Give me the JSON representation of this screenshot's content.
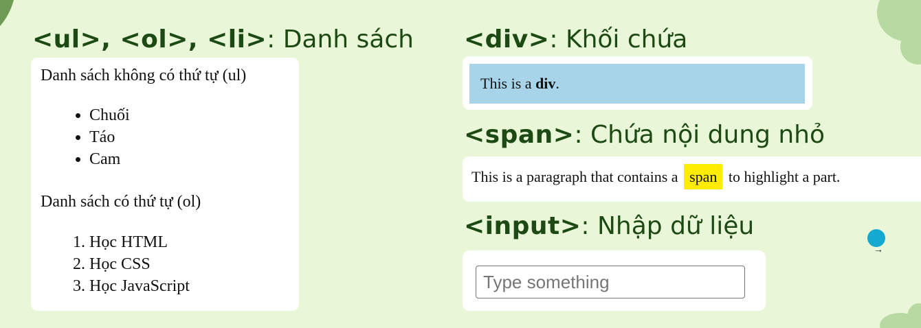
{
  "headings": {
    "lists": {
      "tag": "<ul>, <ol>, <li>",
      "text": ": Danh sách"
    },
    "div": {
      "tag": "<div>",
      "text": ": Khối chứa"
    },
    "span": {
      "tag": "<span>",
      "text": ": Chứa nội dung nhỏ"
    },
    "input": {
      "tag": "<input>",
      "text": ": Nhập dữ liệu"
    }
  },
  "unordered_list": {
    "heading": "Danh sách không có thứ tự (ul)",
    "items": [
      "Chuối",
      "Táo",
      "Cam"
    ]
  },
  "ordered_list": {
    "heading": "Danh sách có thứ tự (ol)",
    "items": [
      "Học HTML",
      "Học CSS",
      "Học JavaScript"
    ]
  },
  "div_demo": {
    "prefix": "This is a ",
    "bold": "div",
    "suffix": "."
  },
  "span_demo": {
    "before": "This is a paragraph that contains a",
    "highlight": "span",
    "after": "to highlight a part."
  },
  "input_demo": {
    "placeholder": "Type something",
    "value": ""
  },
  "cursor": {
    "arrow_glyph": "→"
  },
  "colors": {
    "background": "#e9f7d8",
    "heading_text": "#1d4a14",
    "div_fill": "#a8d4ea",
    "span_highlight": "#ffec00",
    "cursor_dot": "#13a9d0",
    "decor_blob": "#b9d9a3"
  }
}
